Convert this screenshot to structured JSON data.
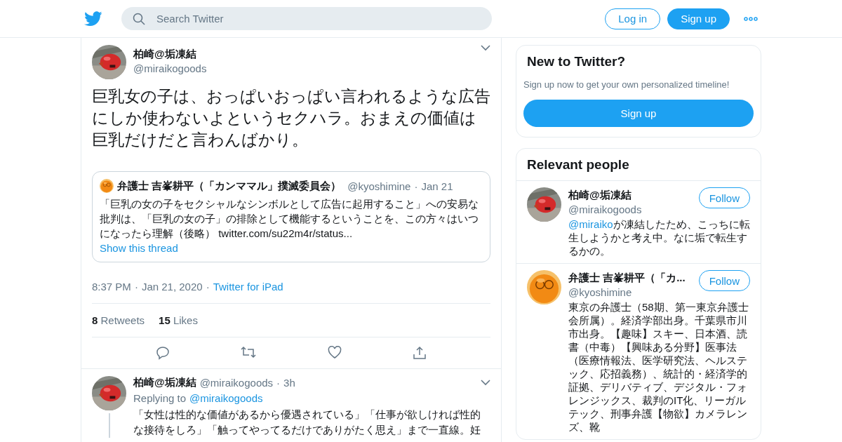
{
  "header": {
    "search_placeholder": "Search Twitter",
    "login": "Log in",
    "signup": "Sign up"
  },
  "tweet": {
    "name": "柏崎@垢凍結",
    "handle": "@miraikogoods",
    "text": "巨乳女の子は、おっぱいおっぱい言われるような広告にしか使わないよというセクハラ。おまえの価値は巨乳だけだと言わんばかり。",
    "quote": {
      "name": "弁護士 吉峯耕平（「カンママル」撲滅委員会）",
      "handle": "@kyoshimine",
      "separator": "·",
      "date": "Jan 21",
      "text": "「巨乳の女の子をセクシャルなシンボルとして広告に起用すること」への安易な批判は、「巨乳の女の子」の排除として機能するということを、この方々はいつになったら理解（後略）",
      "link": "twitter.com/su22m4r/status...",
      "show_thread": "Show this thread"
    },
    "time": "8:37 PM",
    "separator_1": "·",
    "date": "Jan 21, 2020",
    "separator_2": "·",
    "source": "Twitter for iPad",
    "retweets_count": "8",
    "retweets_label": "Retweets",
    "likes_count": "15",
    "likes_label": "Likes"
  },
  "reply": {
    "name": "柏崎@垢凍結",
    "handle": "@miraikogoods",
    "separator": "·",
    "time": "3h",
    "replying_label": "Replying to",
    "replying_to": "@miraikogoods",
    "text": "「女性は性的な価値があるから優遇されている」「仕事が欲しければ性的な接待をしろ」「触ってやってるだけでありがたく思え」まで一直線。妊"
  },
  "sidebar": {
    "signup_card": {
      "title": "New to Twitter?",
      "subtitle": "Sign up now to get your own personalized timeline!",
      "button": "Sign up"
    },
    "relevant": {
      "title": "Relevant people",
      "people": [
        {
          "name": "柏崎@垢凍結",
          "handle": "@miraikogoods",
          "follow": "Follow",
          "bio_mention": "@miraiko",
          "bio": "が凍結したため、こっちに転生しようかと考え中。なに垢で転生するかの。"
        },
        {
          "name": "弁護士 吉峯耕平（「カ...",
          "handle": "@kyoshimine",
          "follow": "Follow",
          "bio": "東京の弁護士（58期、第一東京弁護士会所属）。経済学部出身。千葉県市川市出身。【趣味】スキー、日本酒、読書（中毒）【興味ある分野】医事法（医療情報法、医学研究法、ヘルステック、応招義務）、統計的・経済学的証拠、デリバティブ、デジタル・フォレンジックス、裁判のIT化、リーガルテック、刑事弁護【物欲】カメラレンズ、靴"
        }
      ]
    }
  }
}
